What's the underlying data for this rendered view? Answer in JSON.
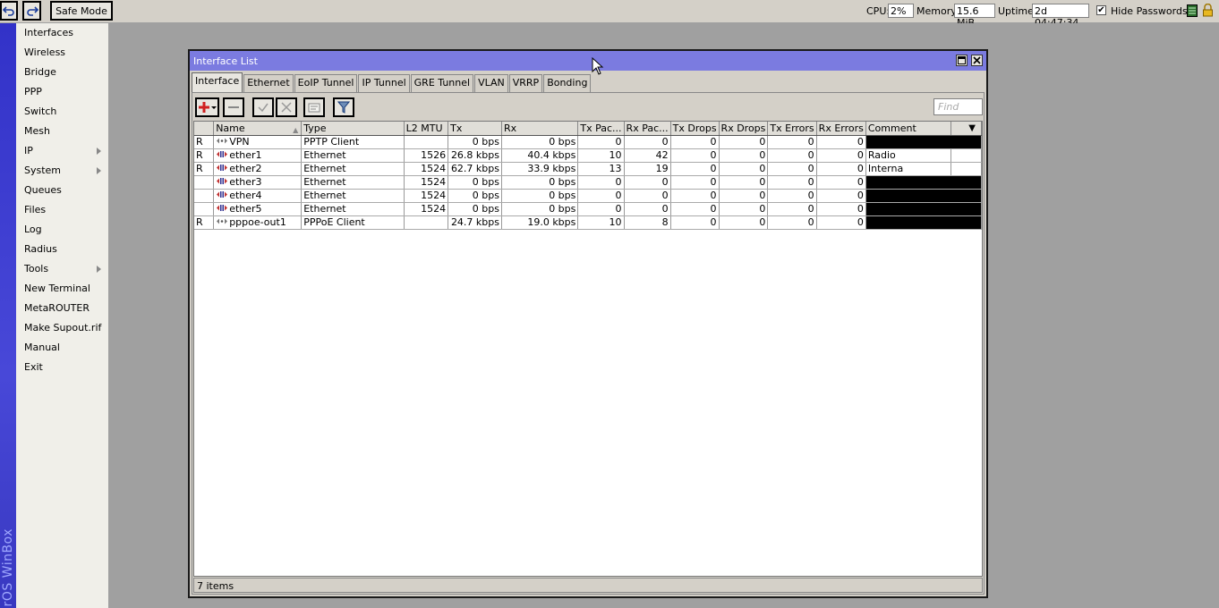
{
  "toolbar": {
    "safe_mode": "Safe Mode",
    "cpu_label": "CPU:",
    "cpu_value": "2%",
    "memory_label": "Memory:",
    "memory_value": "15.6 MiB",
    "uptime_label": "Uptime:",
    "uptime_value": "2d 04:47:34",
    "hide_passwords_label": "Hide Passwords",
    "hide_passwords_checked": "✔"
  },
  "brand": "rOS WinBox",
  "sidebar": {
    "items": [
      {
        "label": "Interfaces",
        "submenu": false
      },
      {
        "label": "Wireless",
        "submenu": false
      },
      {
        "label": "Bridge",
        "submenu": false
      },
      {
        "label": "PPP",
        "submenu": false
      },
      {
        "label": "Switch",
        "submenu": false
      },
      {
        "label": "Mesh",
        "submenu": false
      },
      {
        "label": "IP",
        "submenu": true
      },
      {
        "label": "System",
        "submenu": true
      },
      {
        "label": "Queues",
        "submenu": false
      },
      {
        "label": "Files",
        "submenu": false
      },
      {
        "label": "Log",
        "submenu": false
      },
      {
        "label": "Radius",
        "submenu": false
      },
      {
        "label": "Tools",
        "submenu": true
      },
      {
        "label": "New Terminal",
        "submenu": false
      },
      {
        "label": "MetaROUTER",
        "submenu": false
      },
      {
        "label": "Make Supout.rif",
        "submenu": false
      },
      {
        "label": "Manual",
        "submenu": false
      },
      {
        "label": "Exit",
        "submenu": false
      }
    ]
  },
  "window": {
    "title": "Interface List",
    "tabs": [
      "Interface",
      "Ethernet",
      "EoIP Tunnel",
      "IP Tunnel",
      "GRE Tunnel",
      "VLAN",
      "VRRP",
      "Bonding"
    ],
    "active_tab": 0,
    "find_placeholder": "Find",
    "columns": [
      "",
      "Name",
      "Type",
      "L2 MTU",
      "Tx",
      "Rx",
      "Tx Pac...",
      "Rx Pac...",
      "Tx Drops",
      "Rx Drops",
      "Tx Errors",
      "Rx Errors",
      "Comment",
      ""
    ],
    "rows": [
      {
        "flag": "R",
        "icon": "tunnel",
        "name": "VPN",
        "type": "PPTP Client",
        "l2mtu": "",
        "tx": "0 bps",
        "rx": "0 bps",
        "txp": "0",
        "rxp": "0",
        "txd": "0",
        "rxd": "0",
        "txe": "0",
        "rxe": "0",
        "comment": "",
        "comment_black": true
      },
      {
        "flag": "R",
        "icon": "ethernet",
        "name": "ether1",
        "type": "Ethernet",
        "l2mtu": "1526",
        "tx": "26.8 kbps",
        "rx": "40.4 kbps",
        "txp": "10",
        "rxp": "42",
        "txd": "0",
        "rxd": "0",
        "txe": "0",
        "rxe": "0",
        "comment": "Radio",
        "comment_black": false
      },
      {
        "flag": "R",
        "icon": "ethernet",
        "name": "ether2",
        "type": "Ethernet",
        "l2mtu": "1524",
        "tx": "62.7 kbps",
        "rx": "33.9 kbps",
        "txp": "13",
        "rxp": "19",
        "txd": "0",
        "rxd": "0",
        "txe": "0",
        "rxe": "0",
        "comment": "Interna",
        "comment_black": false
      },
      {
        "flag": "",
        "icon": "ethernet",
        "name": "ether3",
        "type": "Ethernet",
        "l2mtu": "1524",
        "tx": "0 bps",
        "rx": "0 bps",
        "txp": "0",
        "rxp": "0",
        "txd": "0",
        "rxd": "0",
        "txe": "0",
        "rxe": "0",
        "comment": "",
        "comment_black": true
      },
      {
        "flag": "",
        "icon": "ethernet",
        "name": "ether4",
        "type": "Ethernet",
        "l2mtu": "1524",
        "tx": "0 bps",
        "rx": "0 bps",
        "txp": "0",
        "rxp": "0",
        "txd": "0",
        "rxd": "0",
        "txe": "0",
        "rxe": "0",
        "comment": "",
        "comment_black": true
      },
      {
        "flag": "",
        "icon": "ethernet",
        "name": "ether5",
        "type": "Ethernet",
        "l2mtu": "1524",
        "tx": "0 bps",
        "rx": "0 bps",
        "txp": "0",
        "rxp": "0",
        "txd": "0",
        "rxd": "0",
        "txe": "0",
        "rxe": "0",
        "comment": "",
        "comment_black": true
      },
      {
        "flag": "R",
        "icon": "tunnel",
        "name": "pppoe-out1",
        "type": "PPPoE Client",
        "l2mtu": "",
        "tx": "24.7 kbps",
        "rx": "19.0 kbps",
        "txp": "10",
        "rxp": "8",
        "txd": "0",
        "rxd": "0",
        "txe": "0",
        "rxe": "0",
        "comment": "",
        "comment_black": true
      }
    ],
    "status": "7 items"
  },
  "colors": {
    "title_bar": "#7b7be0",
    "brand_strip": "#3a3ac8",
    "workspace": "#a0a0a0",
    "add_icon": "#d02020"
  }
}
